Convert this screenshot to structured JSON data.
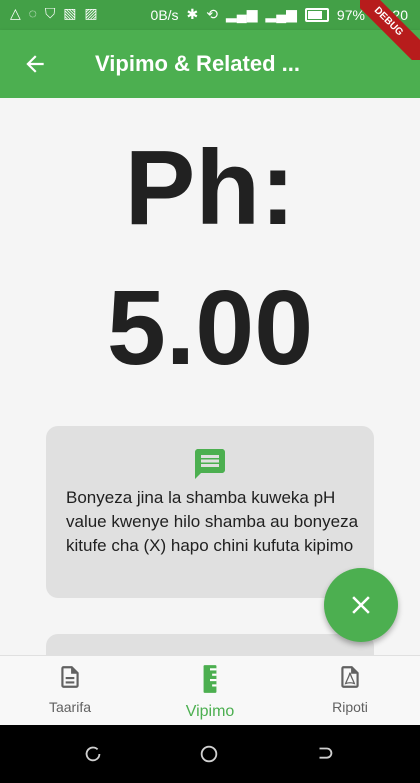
{
  "status_bar": {
    "network_speed": "0B/s",
    "battery_percent": "97%",
    "time": "21:20"
  },
  "app_bar": {
    "title": "Vipimo & Related ..."
  },
  "debug_banner": "DEBUG",
  "reading": {
    "label": "Ph:",
    "value": "5.00"
  },
  "info_card": {
    "icon": "message-icon",
    "text": "Bonyeza jina la shamba kuweka pH value kwenye hilo shamba au bonyeza kitufe cha (X) hapo chini kufuta kipimo"
  },
  "fab": {
    "icon": "close-icon"
  },
  "bottom_nav": {
    "items": [
      {
        "label": "Taarifa",
        "icon": "document-icon"
      },
      {
        "label": "Vipimo",
        "icon": "ruler-icon"
      },
      {
        "label": "Ripoti",
        "icon": "pdf-icon"
      }
    ],
    "selected": "Vipimo"
  },
  "colors": {
    "primary": "#4caf50",
    "status_bar": "#43a047",
    "selected_tab": "#4caf50",
    "text": "#212121"
  }
}
